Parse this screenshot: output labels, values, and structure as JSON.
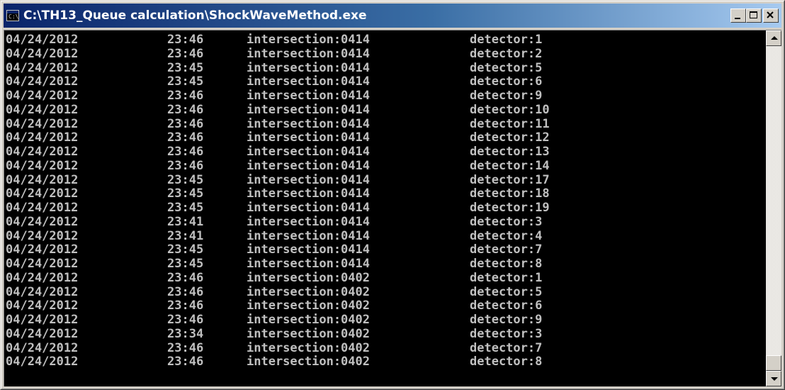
{
  "window": {
    "title": "C:\\TH13_Queue calculation\\ShockWaveMethod.exe",
    "icon": "console-app-icon",
    "icon_text": "C:\\",
    "controls": [
      "minimize",
      "maximize",
      "close"
    ]
  },
  "console": {
    "text_color": "#c0c0c0",
    "background": "#000000",
    "scroll_position": 1.0,
    "rows": [
      {
        "date": "04/24/2012",
        "time": "23:46",
        "intersection": "intersection:0414",
        "detector": "detector:1"
      },
      {
        "date": "04/24/2012",
        "time": "23:46",
        "intersection": "intersection:0414",
        "detector": "detector:2"
      },
      {
        "date": "04/24/2012",
        "time": "23:45",
        "intersection": "intersection:0414",
        "detector": "detector:5"
      },
      {
        "date": "04/24/2012",
        "time": "23:45",
        "intersection": "intersection:0414",
        "detector": "detector:6"
      },
      {
        "date": "04/24/2012",
        "time": "23:46",
        "intersection": "intersection:0414",
        "detector": "detector:9"
      },
      {
        "date": "04/24/2012",
        "time": "23:46",
        "intersection": "intersection:0414",
        "detector": "detector:10"
      },
      {
        "date": "04/24/2012",
        "time": "23:46",
        "intersection": "intersection:0414",
        "detector": "detector:11"
      },
      {
        "date": "04/24/2012",
        "time": "23:46",
        "intersection": "intersection:0414",
        "detector": "detector:12"
      },
      {
        "date": "04/24/2012",
        "time": "23:46",
        "intersection": "intersection:0414",
        "detector": "detector:13"
      },
      {
        "date": "04/24/2012",
        "time": "23:46",
        "intersection": "intersection:0414",
        "detector": "detector:14"
      },
      {
        "date": "04/24/2012",
        "time": "23:45",
        "intersection": "intersection:0414",
        "detector": "detector:17"
      },
      {
        "date": "04/24/2012",
        "time": "23:45",
        "intersection": "intersection:0414",
        "detector": "detector:18"
      },
      {
        "date": "04/24/2012",
        "time": "23:45",
        "intersection": "intersection:0414",
        "detector": "detector:19"
      },
      {
        "date": "04/24/2012",
        "time": "23:41",
        "intersection": "intersection:0414",
        "detector": "detector:3"
      },
      {
        "date": "04/24/2012",
        "time": "23:41",
        "intersection": "intersection:0414",
        "detector": "detector:4"
      },
      {
        "date": "04/24/2012",
        "time": "23:45",
        "intersection": "intersection:0414",
        "detector": "detector:7"
      },
      {
        "date": "04/24/2012",
        "time": "23:45",
        "intersection": "intersection:0414",
        "detector": "detector:8"
      },
      {
        "date": "04/24/2012",
        "time": "23:46",
        "intersection": "intersection:0402",
        "detector": "detector:1"
      },
      {
        "date": "04/24/2012",
        "time": "23:46",
        "intersection": "intersection:0402",
        "detector": "detector:5"
      },
      {
        "date": "04/24/2012",
        "time": "23:46",
        "intersection": "intersection:0402",
        "detector": "detector:6"
      },
      {
        "date": "04/24/2012",
        "time": "23:46",
        "intersection": "intersection:0402",
        "detector": "detector:9"
      },
      {
        "date": "04/24/2012",
        "time": "23:34",
        "intersection": "intersection:0402",
        "detector": "detector:3"
      },
      {
        "date": "04/24/2012",
        "time": "23:46",
        "intersection": "intersection:0402",
        "detector": "detector:7"
      },
      {
        "date": "04/24/2012",
        "time": "23:46",
        "intersection": "intersection:0402",
        "detector": "detector:8"
      }
    ]
  }
}
